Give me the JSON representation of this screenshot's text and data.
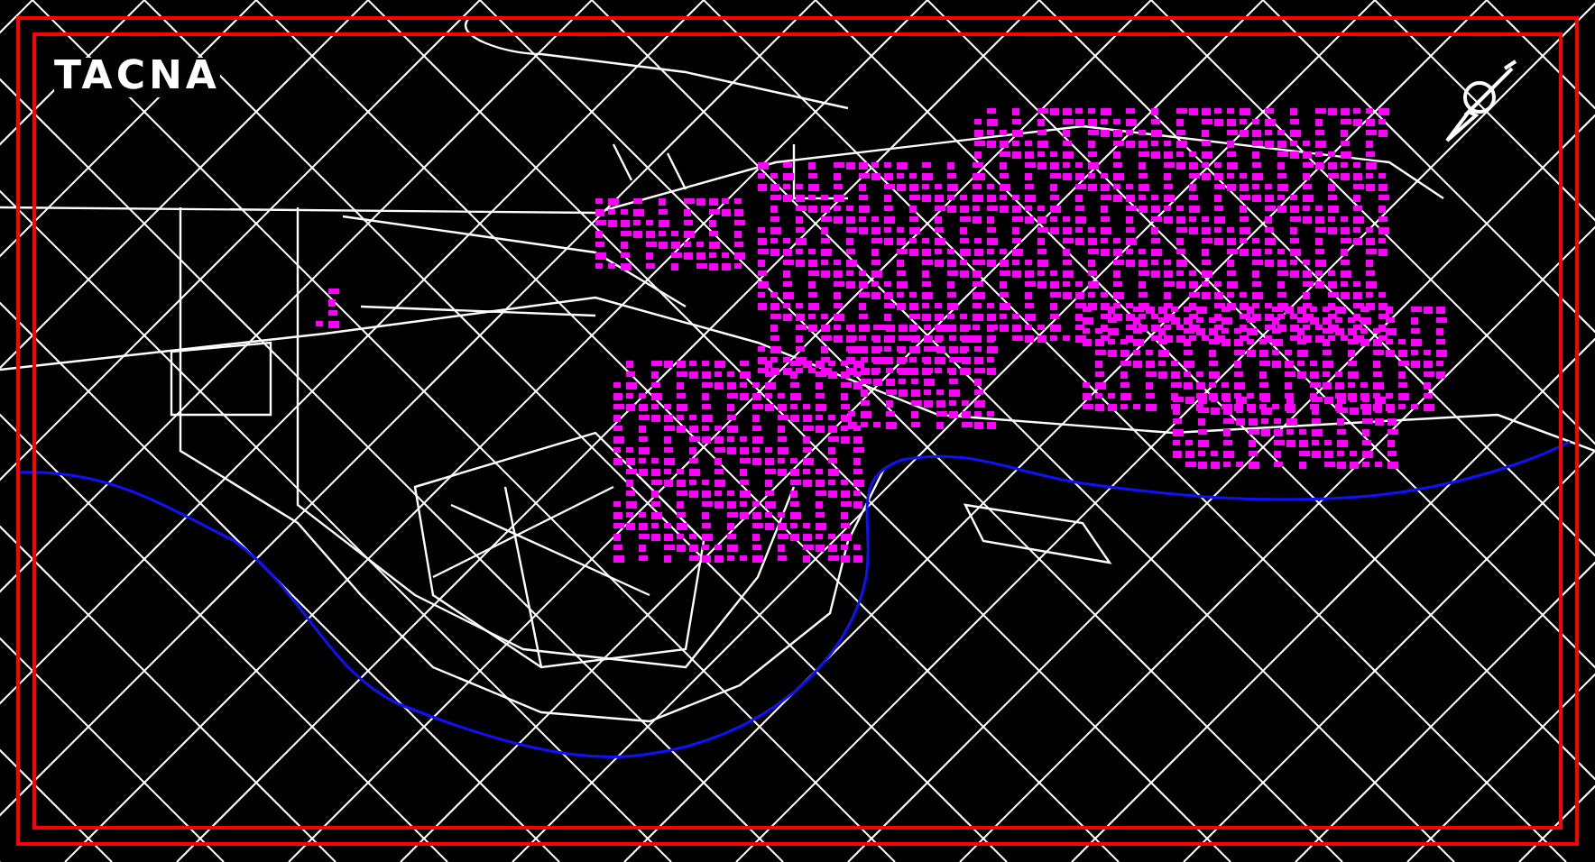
{
  "title": "TACNA"
}
